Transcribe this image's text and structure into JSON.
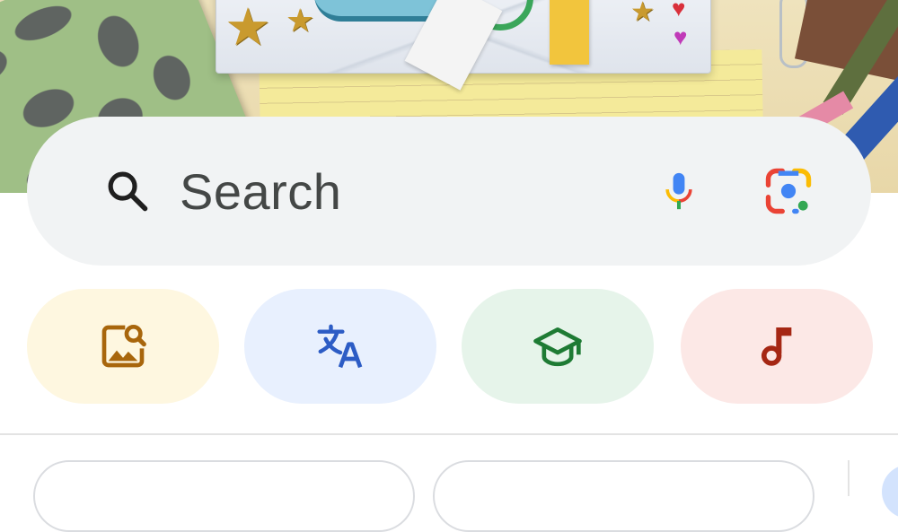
{
  "search": {
    "placeholder": "Search",
    "voice_search_icon": "microphone-icon",
    "lens_icon": "google-lens-icon",
    "search_icon": "magnifier-icon"
  },
  "doodle": {
    "description_icon": "doodle-collage-banner"
  },
  "quick_actions": [
    {
      "icon": "image-search-icon",
      "color": "#a8660c",
      "background": "#fef7e0"
    },
    {
      "icon": "translate-icon",
      "color": "#2c5cc5",
      "background": "#e8f0fe"
    },
    {
      "icon": "graduation-cap-icon",
      "color": "#1e7b34",
      "background": "#e6f4ea"
    },
    {
      "icon": "music-note-icon",
      "color": "#a52714",
      "background": "#fce8e6"
    }
  ],
  "suggestions": [
    {
      "label": ""
    },
    {
      "label": ""
    }
  ],
  "colors": {
    "google_blue": "#4285F4",
    "google_red": "#EA4335",
    "google_yellow": "#FBBC04",
    "google_green": "#34A853",
    "search_bar_bg": "#f1f3f4"
  }
}
